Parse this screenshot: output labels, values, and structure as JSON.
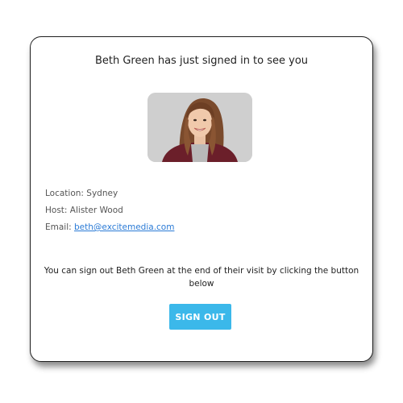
{
  "card": {
    "title": "Beth Green has just signed in to see you"
  },
  "visitor": {
    "photo_icon": "visitor-photo",
    "location_label": "Location:",
    "location_value": "Sydney",
    "host_label": "Host:",
    "host_value": "Alister Wood",
    "email_label": "Email:",
    "email_value": "beth@excitemedia.com"
  },
  "note": {
    "line1": "You can sign out Beth Green at the end of their visit by clicking the button",
    "line2": "below"
  },
  "actions": {
    "signout_label": "SIGN OUT"
  },
  "colors": {
    "accent": "#3bb8ea",
    "link": "#2b7bd6",
    "photo_bg": "#cfcfcf"
  }
}
